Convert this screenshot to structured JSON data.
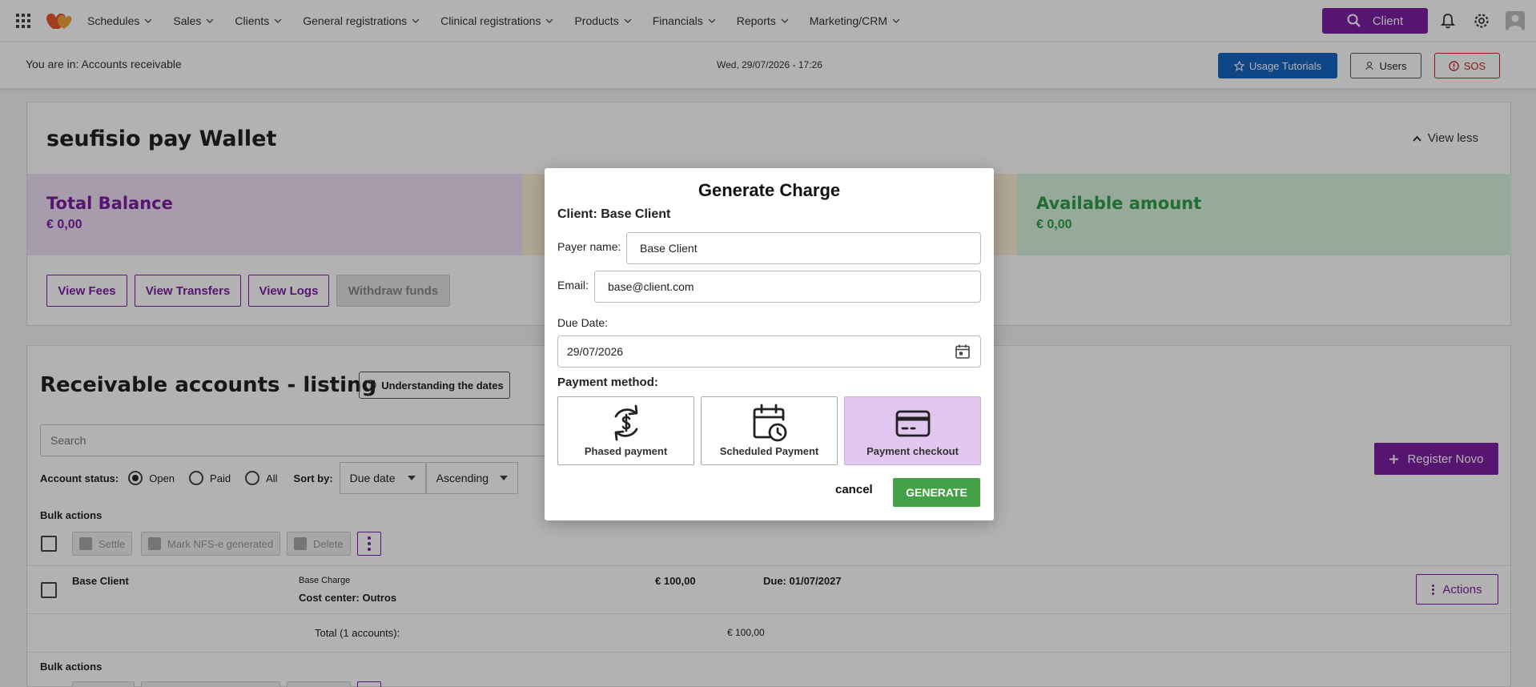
{
  "nav": {
    "items": [
      "Schedules",
      "Sales",
      "Clients",
      "General registrations",
      "Clinical registrations",
      "Products",
      "Financials",
      "Reports",
      "Marketing/CRM"
    ],
    "client_button": "Client"
  },
  "location": {
    "text": "You are in: Accounts receivable",
    "datetime": "Wed, 29/07/2026 - 17:26",
    "tutorials_button": "Usage Tutorials",
    "users_button": "Users",
    "sos_button": "SOS"
  },
  "wallet": {
    "title": "seufisio pay Wallet",
    "view_less": "View less",
    "panels": [
      {
        "title": "Total Balance",
        "value": "€ 0,00",
        "color": "#7b1fa2"
      },
      {
        "title": "",
        "value": "",
        "color": "#d4a017"
      },
      {
        "title": "Available amount",
        "value": "€ 0,00",
        "color": "#2e9e46"
      }
    ],
    "buttons": [
      "View Fees",
      "View Transfers",
      "View Logs",
      "Withdraw funds"
    ]
  },
  "listing": {
    "title": "Receivable accounts - listing",
    "understanding_button": "Understanding the dates",
    "search_placeholder": "Search",
    "register_button": "Register Novo",
    "account_status_label": "Account status:",
    "status_options": [
      "Open",
      "Paid",
      "All"
    ],
    "sort_label": "Sort by:",
    "sort_field": "Due date",
    "sort_order": "Ascending",
    "bulk_label": "Bulk actions",
    "bulk_buttons": [
      "Settle",
      "Mark NFS-e generated",
      "Delete"
    ],
    "rows": [
      {
        "client": "Base Client",
        "desc": "Base Charge",
        "cost_center": "Cost center: Outros",
        "amount": "€ 100,00",
        "due": "Due: 01/07/2027",
        "actions": "Actions"
      }
    ],
    "total_label": "Total (1 accounts):",
    "total_value": "€ 100,00"
  },
  "modal": {
    "title": "Generate Charge",
    "client": "Client: Base Client",
    "payer_label": "Payer name:",
    "payer_value": "Base Client",
    "email_label": "Email:",
    "email_value": "base@client.com",
    "due_label": "Due Date:",
    "due_value": "29/07/2026",
    "payment_label": "Payment method:",
    "payment_options": [
      "Phased payment",
      "Scheduled Payment",
      "Payment checkout"
    ],
    "selected_payment": "Payment checkout",
    "cancel": "cancel",
    "generate": "GENERATE"
  }
}
